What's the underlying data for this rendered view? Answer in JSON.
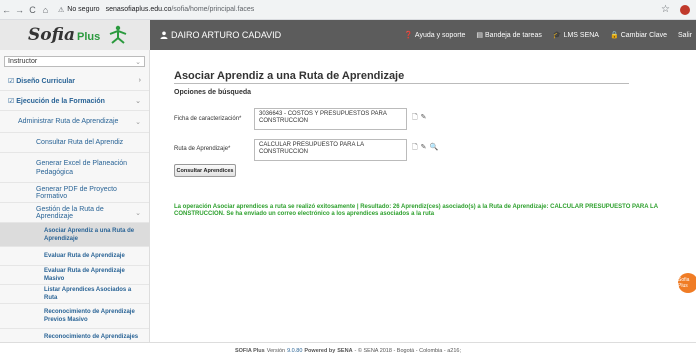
{
  "browser": {
    "back": "←",
    "forward": "→",
    "reload": "C",
    "home": "⌂",
    "security_label": "No seguro",
    "url_host": "senasofiaplus.edu.co",
    "url_path": "/sofia/home/principal.faces"
  },
  "header": {
    "logo_text": "Sofia",
    "logo_plus": "Plus",
    "user_name": "DAIRO ARTURO CADAVID",
    "nav": [
      {
        "label": "Ayuda y soporte",
        "icon": "help-icon"
      },
      {
        "label": "Bandeja de tareas",
        "icon": "inbox-icon"
      },
      {
        "label": "LMS SENA",
        "icon": "graduation-cap-icon"
      },
      {
        "label": "Cambiar Clave",
        "icon": "lock-icon"
      },
      {
        "label": "Salir",
        "icon": "logout-icon"
      }
    ]
  },
  "sidebar": {
    "role": "Instructor",
    "items": [
      {
        "label": "Diseño Curricular",
        "level": 1
      },
      {
        "label": "Ejecución de la Formación",
        "level": 1
      },
      {
        "label": "Administrar Ruta de Aprendizaje",
        "level": 2
      },
      {
        "label": "Consultar Ruta del Aprendiz",
        "level": 3
      },
      {
        "label": "Generar Excel de Planeación Pedagógica",
        "level": 3
      },
      {
        "label": "Generar PDF de Proyecto Formativo",
        "level": 3
      },
      {
        "label": "Gestión de la Ruta de Aprendizaje",
        "level": 3
      },
      {
        "label": "Asociar Aprendiz a una Ruta de Aprendizaje",
        "level": 4,
        "active": true
      },
      {
        "label": "Evaluar Ruta de Aprendizaje",
        "level": 4
      },
      {
        "label": "Evaluar Ruta de Aprendizaje Masivo",
        "level": 4
      },
      {
        "label": "Listar Aprendices Asociados a Ruta",
        "level": 4
      },
      {
        "label": "Reconocimiento de Aprendizaje Previos Masivo",
        "level": 4
      },
      {
        "label": "Reconocimiento de Aprendizajes Previos",
        "level": 4
      }
    ]
  },
  "main": {
    "title": "Asociar Aprendiz a una Ruta de Aprendizaje",
    "section": "Opciones de búsqueda",
    "ficha_label": "Ficha de caracterización*",
    "ficha_value": "3036643 - COSTOS Y PRESUPUESTOS PARA CONSTRUCCION",
    "ruta_label": "Ruta de Aprendizaje*",
    "ruta_value": "CALCULAR PRESUPUESTO PARA LA CONSTRUCCION",
    "consult_button": "Consultar Aprendices",
    "success_message": "La operación Asociar aprendices a ruta se realizó exitosamente  | Resultado: 26 Aprendiz(ces) asociado(s) a la Ruta de Aprendizaje: CALCULAR PRESUPUESTO PARA LA CONSTRUCCION. Se ha enviado un correo electrónico a los aprendices asociados a la ruta"
  },
  "floating": {
    "label": "Sofia Plus"
  },
  "footer": {
    "app": "SOFIA Plus",
    "version_label": "Versión",
    "version": "9.0.80",
    "powered": "Powered by",
    "org": "SENA",
    "rest": "- © SENA 2018 - Bogotá - Colombia - a216;"
  }
}
